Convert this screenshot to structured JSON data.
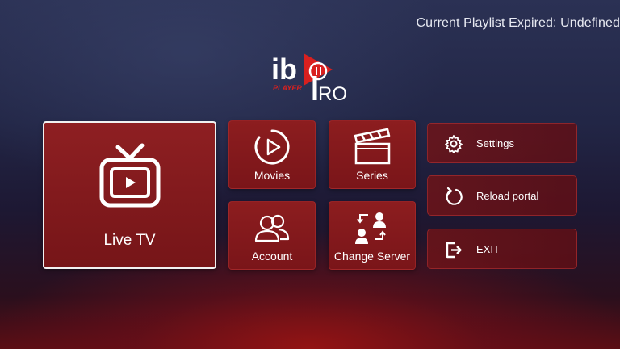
{
  "status_text": "Current Playlist Expired: Undefined",
  "logo": {
    "text_main": "ib",
    "text_pro": "RO",
    "text_sub": "PLAYER"
  },
  "tiles": {
    "live_tv": "Live TV",
    "movies": "Movies",
    "series": "Series",
    "account": "Account",
    "change_server": "Change Server"
  },
  "side_menu": {
    "settings": "Settings",
    "reload_portal": "Reload portal",
    "exit": "EXIT"
  },
  "colors": {
    "tile_red": "#8c1d1f",
    "logo_red": "#d9201f",
    "background_dark": "#222646"
  }
}
